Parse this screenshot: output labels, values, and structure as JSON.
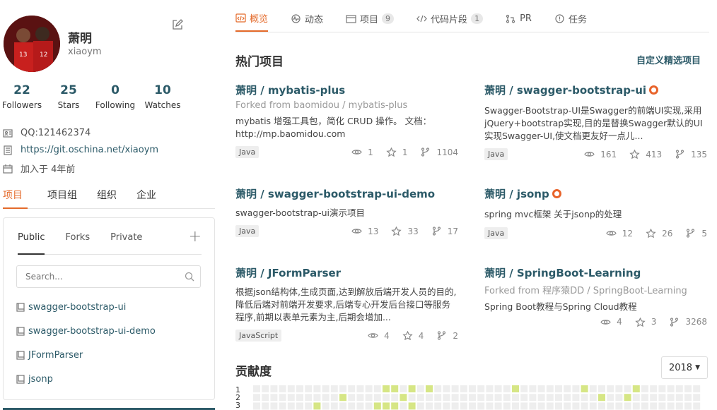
{
  "profile": {
    "name": "萧明",
    "login": "xiaoym",
    "stats": [
      {
        "num": "22",
        "label": "Followers"
      },
      {
        "num": "25",
        "label": "Stars"
      },
      {
        "num": "0",
        "label": "Following"
      },
      {
        "num": "10",
        "label": "Watches"
      }
    ],
    "qq": "QQ:121462374",
    "url": "https://git.oschina.net/xiaoym",
    "joined": "加入于 4年前"
  },
  "side_tabs": [
    "项目",
    "项目组",
    "组织",
    "企业"
  ],
  "repo_box": {
    "tabs": [
      "Public",
      "Forks",
      "Private"
    ],
    "plus": "+",
    "search_placeholder": "Search...",
    "items": [
      "swagger-bootstrap-ui",
      "swagger-bootstrap-ui-demo",
      "JFormParser",
      "jsonp"
    ]
  },
  "top_tabs": [
    {
      "label": "概览",
      "badge": ""
    },
    {
      "label": "动态",
      "badge": ""
    },
    {
      "label": "项目",
      "badge": "9"
    },
    {
      "label": "代码片段",
      "badge": "1"
    },
    {
      "label": "PR",
      "badge": ""
    },
    {
      "label": "任务",
      "badge": ""
    }
  ],
  "hot": {
    "title": "热门项目",
    "customize": "自定义精选项目",
    "projects": [
      {
        "title": "萧明 / mybatis-plus",
        "gvp": false,
        "fork": "Forked from baomidou  / mybatis-plus",
        "desc": "mybatis 增强工具包，简化 CRUD 操作。 文档：http://mp.baomidou.com",
        "lang": "Java",
        "watch": "1",
        "star": "1",
        "fork_count": "1104"
      },
      {
        "title": "萧明 / swagger-bootstrap-ui",
        "gvp": true,
        "fork": "",
        "desc": "Swagger-Bootstrap-UI是Swagger的前端UI实现,采用jQuery+bootstrap实现,目的是替换Swagger默认的UI实现Swagger-UI,使文档更友好一点儿...",
        "lang": "Java",
        "watch": "161",
        "star": "413",
        "fork_count": "135"
      },
      {
        "title": "萧明 / swagger-bootstrap-ui-demo",
        "gvp": false,
        "fork": "",
        "desc": "swagger-bootstrap-ui演示项目",
        "lang": "Java",
        "watch": "13",
        "star": "33",
        "fork_count": "17"
      },
      {
        "title": "萧明 / jsonp",
        "gvp": true,
        "fork": "",
        "desc": "spring mvc框架 关于jsonp的处理",
        "lang": "Java",
        "watch": "12",
        "star": "26",
        "fork_count": "5"
      },
      {
        "title": "萧明 / JFormParser",
        "gvp": false,
        "fork": "",
        "desc": "根据json结构体,生成页面,达到解放后端开发人员的目的,降低后端对前端开发要求,后端专心开发后台接口等服务程序,前期以表单元素为主,后期会增加...",
        "lang": "JavaScript",
        "watch": "4",
        "star": "4",
        "fork_count": "2"
      },
      {
        "title": "萧明 / SpringBoot-Learning",
        "gvp": false,
        "fork": "Forked from 程序猿DD  / SpringBoot-Learning",
        "desc": "Spring Boot教程与Spring Cloud教程",
        "lang": "",
        "watch": "4",
        "star": "3",
        "fork_count": "3268"
      }
    ]
  },
  "contrib": {
    "title": "贡献度",
    "year": "2018",
    "row_labels": [
      "1",
      "2",
      "3"
    ],
    "color_empty": "#eeeeee",
    "color_active": "#d6e685",
    "active_cells": [
      [
        0,
        15
      ],
      [
        0,
        16
      ],
      [
        0,
        18
      ],
      [
        0,
        20
      ],
      [
        0,
        30
      ],
      [
        0,
        38
      ],
      [
        0,
        44
      ],
      [
        1,
        10
      ],
      [
        1,
        17
      ],
      [
        1,
        40
      ],
      [
        1,
        43
      ],
      [
        2,
        7
      ],
      [
        2,
        14
      ],
      [
        2,
        15
      ],
      [
        2,
        16
      ],
      [
        2,
        18
      ]
    ]
  }
}
